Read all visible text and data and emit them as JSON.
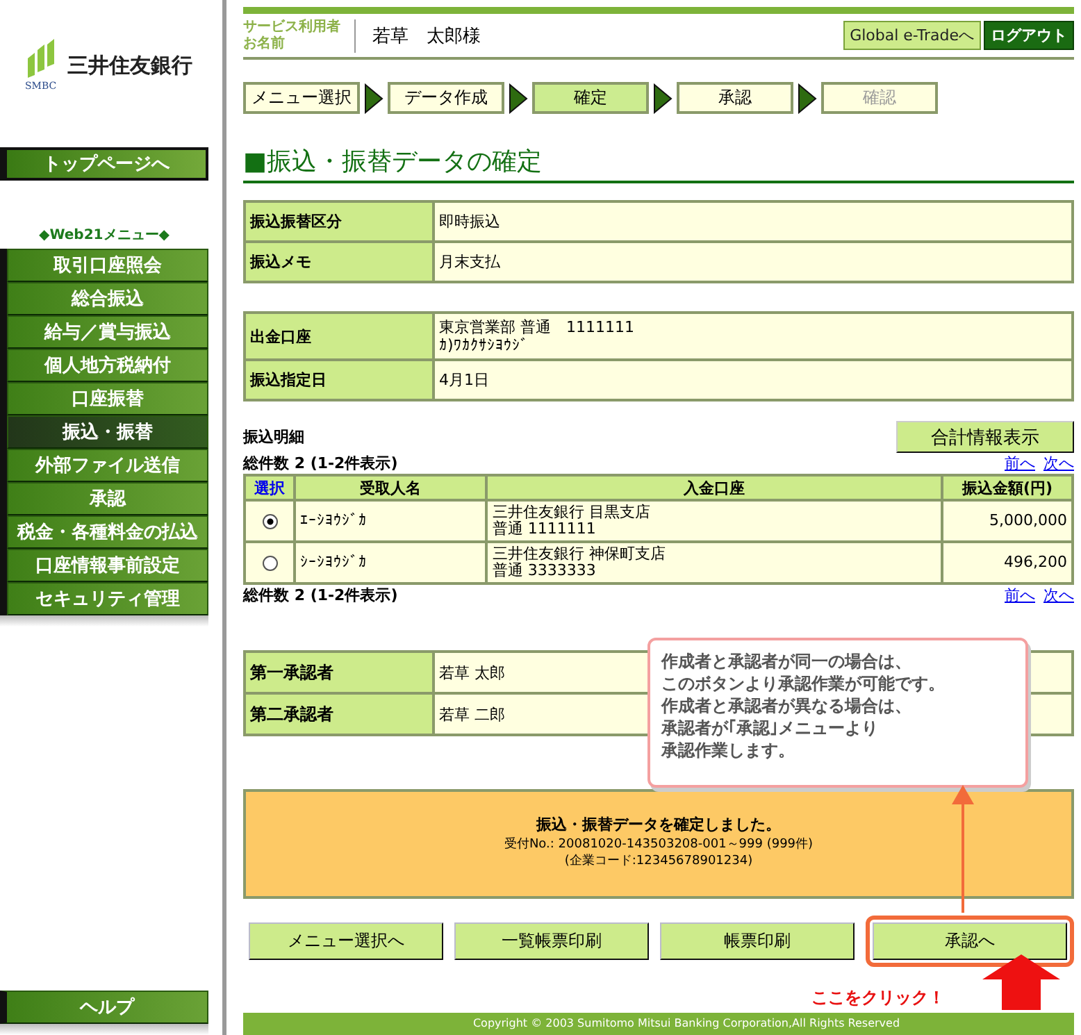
{
  "logo": {
    "name": "三井住友銀行",
    "mark": "SMBC"
  },
  "sidebar": {
    "top_button": "トップページへ",
    "menu_title": "◆Web21メニュー◆",
    "items": [
      {
        "label": "取引口座照会",
        "selected": false
      },
      {
        "label": "総合振込",
        "selected": false
      },
      {
        "label": "給与／賞与振込",
        "selected": false
      },
      {
        "label": "個人地方税納付",
        "selected": false
      },
      {
        "label": "口座振替",
        "selected": false
      },
      {
        "label": "振込・振替",
        "selected": true
      },
      {
        "label": "外部ファイル送信",
        "selected": false
      },
      {
        "label": "承認",
        "selected": false
      },
      {
        "label": "税金・各種料金の払込",
        "selected": false
      },
      {
        "label": "口座情報事前設定",
        "selected": false
      },
      {
        "label": "セキュリティ管理",
        "selected": false
      }
    ],
    "help_button": "ヘルプ"
  },
  "header": {
    "user_label": [
      "サービス利用者",
      "お名前"
    ],
    "user_name": "若草　太郎様",
    "links": [
      {
        "label": "Global e-Tradeへ",
        "kind": "light"
      },
      {
        "label": "ログアウト",
        "kind": "dark"
      }
    ]
  },
  "steps": [
    {
      "label": "メニュー選択",
      "selected": false,
      "disabled": false
    },
    {
      "label": "データ作成",
      "selected": false,
      "disabled": false
    },
    {
      "label": "確定",
      "selected": true,
      "disabled": false
    },
    {
      "label": "承認",
      "selected": false,
      "disabled": false
    },
    {
      "label": "確認",
      "selected": false,
      "disabled": true
    }
  ],
  "page_title": "■振込・振替データの確定",
  "summary_tables": [
    [
      {
        "label": "振込振替区分",
        "lines": [
          "即時振込"
        ]
      },
      {
        "label": "振込メモ",
        "lines": [
          "月末支払"
        ]
      }
    ],
    [
      {
        "label": "出金口座",
        "lines": [
          "東京営業部 普通　1111111",
          "ｶ)ﾜｶｸｻｼﾖｳｼﾞ"
        ]
      },
      {
        "label": "振込指定日",
        "lines": [
          "4月1日"
        ]
      }
    ]
  ],
  "details": {
    "title": "振込明細",
    "totals_button": "合計情報表示",
    "count_top": "総件数 2 (1-2件表示)",
    "pager_top": [
      "前へ",
      "次へ"
    ],
    "columns": [
      {
        "label": "選択",
        "link": true
      },
      {
        "label": "受取人名",
        "link": false
      },
      {
        "label": "入金口座",
        "link": false
      },
      {
        "label": "振込金額(円)",
        "link": false
      }
    ],
    "rows": [
      {
        "selected": true,
        "payee": "ｴｰｼﾖｳｼﾞｶ",
        "account": [
          "三井住友銀行 目黒支店",
          "普通 1111111"
        ],
        "amount": "5,000,000"
      },
      {
        "selected": false,
        "payee": "ｼｰｼﾖｳｼﾞｶ",
        "account": [
          "三井住友銀行 神保町支店",
          "普通 3333333"
        ],
        "amount": "496,200"
      }
    ],
    "count_bottom": "総件数 2 (1-2件表示)",
    "pager_bottom": [
      "前へ",
      "次へ"
    ]
  },
  "approvers": [
    {
      "label": "第一承認者",
      "value": "若草 太郎"
    },
    {
      "label": "第二承認者",
      "value": "若草 二郎"
    }
  ],
  "result": {
    "message": "振込・振替データを確定しました。",
    "lines": [
      "受付No.: 20081020-143503208-001～999 (999件)",
      "(企業コード:12345678901234)"
    ]
  },
  "buttons": [
    {
      "label": "メニュー選択へ",
      "highlighted": false
    },
    {
      "label": "一覧帳票印刷",
      "highlighted": false
    },
    {
      "label": "帳票印刷",
      "highlighted": false
    },
    {
      "label": "承認へ",
      "highlighted": true
    }
  ],
  "callout": {
    "lines": [
      "作成者と承認者が同一の場合は、",
      "このボタンより承認作業が可能です。",
      "作成者と承認者が異なる場合は、",
      "承認者が｢承認｣メニューより",
      "承認作業します。"
    ],
    "click_label": "ここをクリック！"
  },
  "footer": "Copyright © 2003 Sumitomo Mitsui Banking Corporation,All Rights Reserved"
}
